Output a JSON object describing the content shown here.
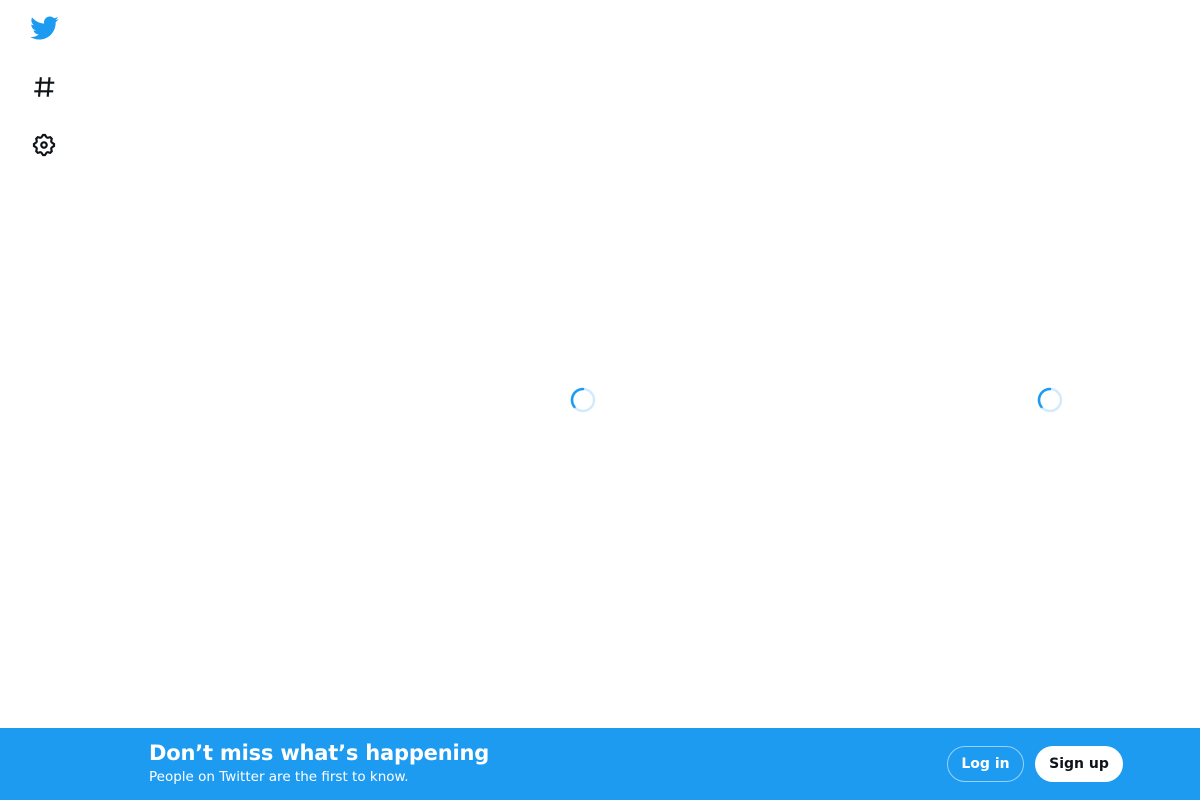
{
  "nav": {
    "items": [
      {
        "icon": "twitter-bird-icon",
        "color": "#1d9bf0"
      },
      {
        "icon": "hashtag-icon",
        "color": "#0f1419"
      },
      {
        "icon": "gear-icon",
        "color": "#0f1419"
      }
    ]
  },
  "loading": {
    "spinner_color": "#1d9bf0"
  },
  "banner": {
    "title": "Don’t miss what’s happening",
    "subtitle": "People on Twitter are the first to know.",
    "login_label": "Log in",
    "signup_label": "Sign up",
    "background": "#1d9bf0"
  }
}
